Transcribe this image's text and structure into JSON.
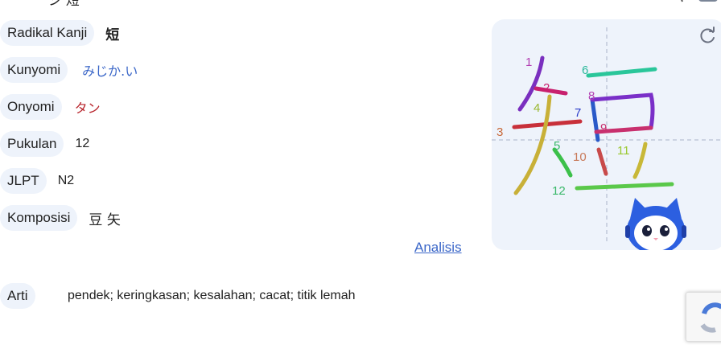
{
  "top_cut_text": "ジ 短",
  "rows": {
    "radikal": {
      "label": "Radikal Kanji",
      "value": "短"
    },
    "kunyomi": {
      "label": "Kunyomi",
      "value": "みじか.い"
    },
    "onyomi": {
      "label": "Onyomi",
      "value": "タン"
    },
    "pukulan": {
      "label": "Pukulan",
      "value": "12"
    },
    "jlpt": {
      "label": "JLPT",
      "value": "N2"
    },
    "komposisi": {
      "label": "Komposisi",
      "value": "豆 矢"
    }
  },
  "analysis_link": "Analisis",
  "arti": {
    "label": "Arti",
    "value": "pendek; keringkasan; kesalahan; cacat; titik lemah"
  },
  "stroke_numbers": [
    "1",
    "2",
    "3",
    "4",
    "5",
    "6",
    "7",
    "8",
    "9",
    "10",
    "11",
    "12"
  ],
  "icons": {
    "refresh": "refresh-icon",
    "mascot": "robot-cat-mascot",
    "captcha": "recaptcha-badge"
  },
  "colors": {
    "pill_bg": "#eef3fb",
    "kunyomi": "#3a66c8",
    "onyomi": "#b8242c",
    "link": "#3a66c8"
  }
}
